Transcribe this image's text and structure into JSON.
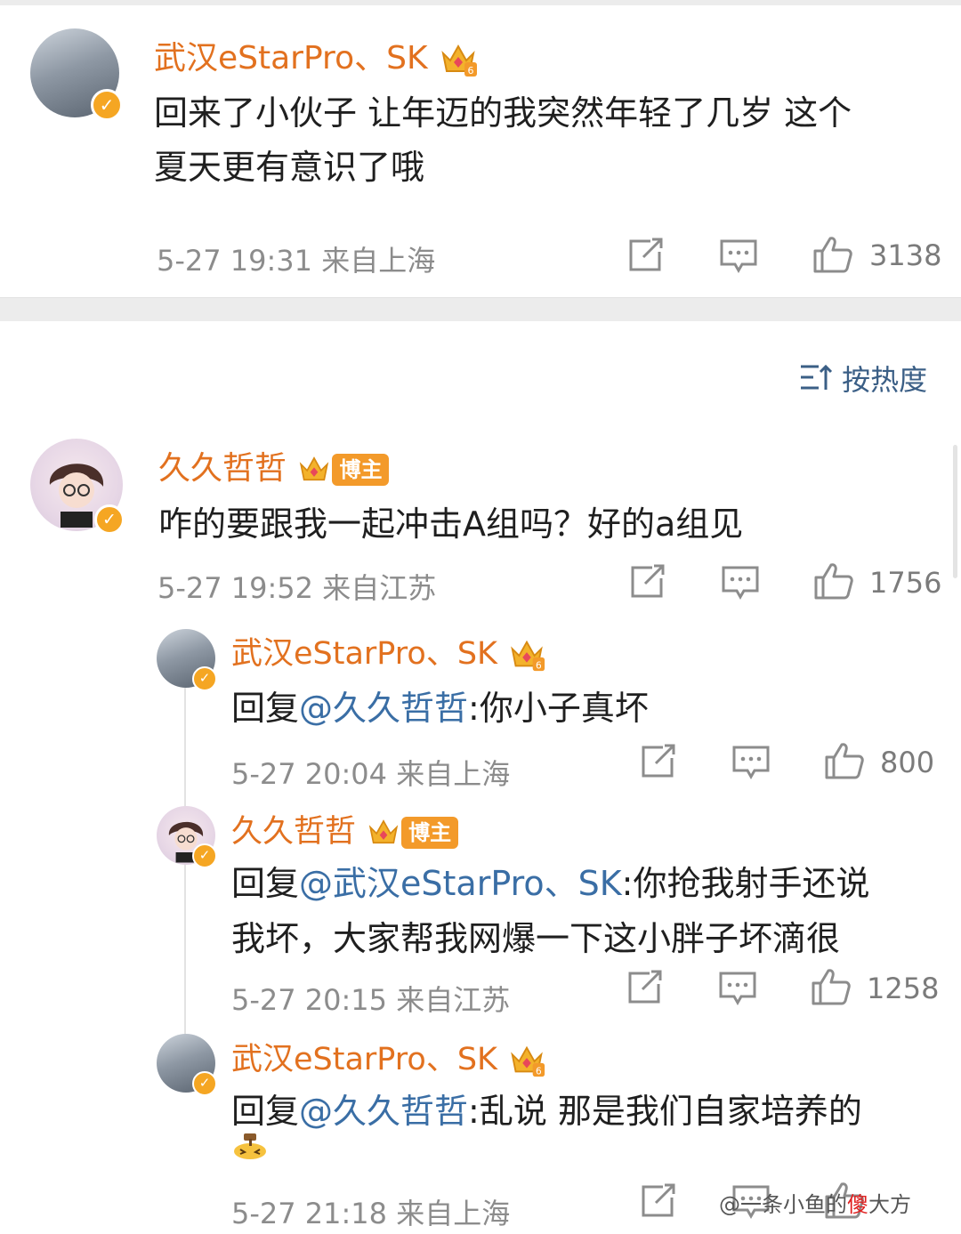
{
  "main_comment": {
    "author": "武汉eStarPro、SK",
    "text_line1": "回来了小伙子 让年迈的我突然年轻了几岁 这个",
    "text_line2": "夏天更有意识了哦",
    "time": "5-27 19:31",
    "location": "来自上海",
    "likes": "3138"
  },
  "sort": {
    "label": "按热度",
    "icon": "sort-icon"
  },
  "comments": [
    {
      "author": "久久哲哲",
      "tag": "博主",
      "text": "咋的要跟我一起冲击A组吗？好的a组见",
      "time": "5-27 19:52",
      "location": "来自江苏",
      "likes": "1756"
    }
  ],
  "replies": [
    {
      "author": "武汉eStarPro、SK",
      "prefix": "回复",
      "mention": "@久久哲哲",
      "text": ":你小子真坏",
      "time": "5-27 20:04",
      "location": "来自上海",
      "likes": "800"
    },
    {
      "author": "久久哲哲",
      "tag": "博主",
      "prefix": "回复",
      "mention": "@武汉eStarPro、SK",
      "text": ":你抢我射手还说",
      "text_line2": "我坏，大家帮我网爆一下这小胖子坏滴很",
      "time": "5-27 20:15",
      "location": "来自江苏",
      "likes": "1258"
    },
    {
      "author": "武汉eStarPro、SK",
      "prefix": "回复",
      "mention": "@久久哲哲",
      "text": ":乱说 那是我们自家培养的",
      "emoji": "hammer-emoji",
      "time": "5-27 21:18",
      "location": "来自上海"
    }
  ],
  "watermark": {
    "text": "@一条小鱼的",
    "highlight": "傻",
    "tail": "大方"
  },
  "colors": {
    "name": "#e2711f",
    "mention": "#3a6ea5",
    "meta": "#8c8c8c",
    "badge": "#f5a623"
  }
}
